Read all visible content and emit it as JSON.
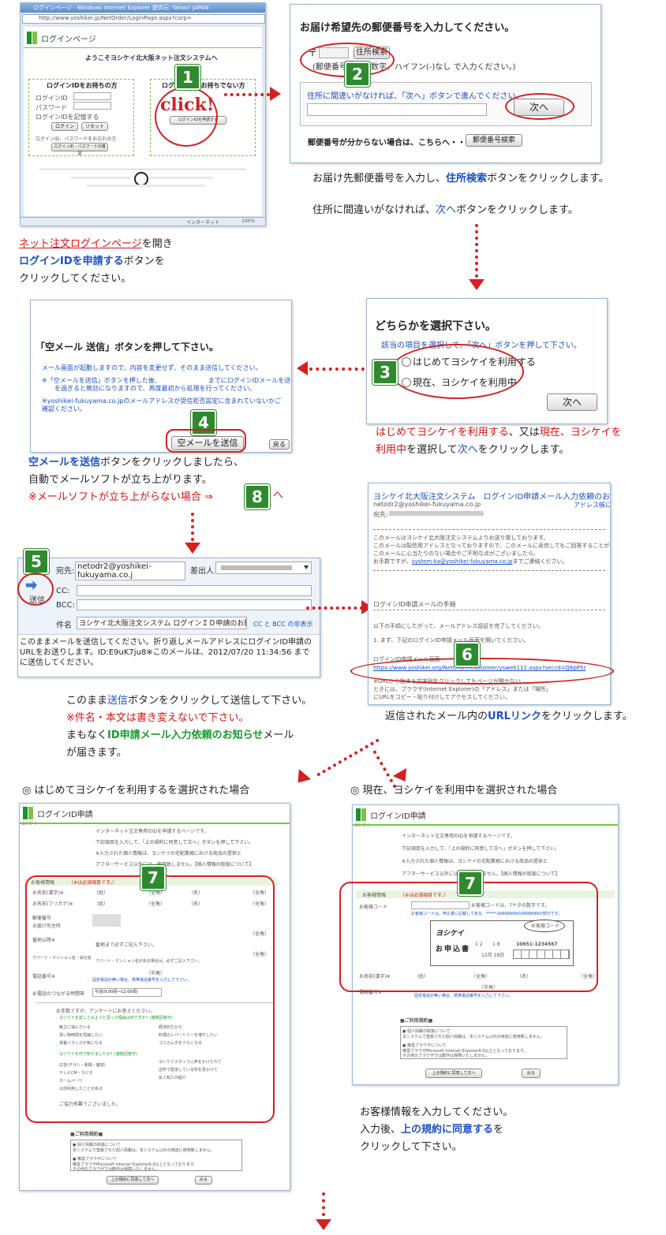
{
  "step1": {
    "window_title": "ログインページ - Windows Internet Explorer 提供元: Yahoo! JAPAN",
    "address": "http://www.yoshikei.jp/NetOrder/LoginPage.aspx?corp=",
    "page_header": "ログインページ",
    "welcome": "ようこそヨシケイ北大阪ネット注文システムへ",
    "box_left_title": "ログインIDをお持ちの方",
    "box_right_title": "ログインIDをお持ちでない方",
    "login_id_label": "ログインID",
    "password_label": "パスワード",
    "remember_label": "ログインIDを記憶する",
    "login_btn": "ログイン",
    "reset_btn": "リセット",
    "forgot_label": "ログインID、パスワードをお忘れの方",
    "forgot_btn": "ログインID・パスワードの確認",
    "apply_btn": "ログインIDを申請する",
    "click_text": "click!",
    "status_internet": "インターネット",
    "status_zoom": "100%",
    "caption_link": "ネット注文ログインページ",
    "caption_line1_rest": "を開き",
    "caption_blue": "ログインIDを申請する",
    "caption_line2_rest": "ボタンを",
    "caption_line3": "クリックしてください。"
  },
  "step2": {
    "heading": "お届け希望先の郵便番号を入力してください。",
    "postal_mark": "〒",
    "search_btn": "住所検索",
    "hint": "(郵便番号は半角数字、ハイフン(-)なし で入力ください。)",
    "address_prompt": "住所に間違いがなければ、「次へ」ボタンで進んでください。",
    "next_btn": "次へ",
    "unknown_label": "郵便番号が分からない場合は、こちらへ・・・",
    "postal_search_btn": "郵便番号検索",
    "caption1_pre": "お届け先郵便番号を入力し、",
    "caption1_blue": "住所検索",
    "caption1_post": "ボタンをクリックします。",
    "caption2_pre": "住所に間違いがなければ、",
    "caption2_blue": "次へ",
    "caption2_post": "ボタンをクリックします。"
  },
  "step3": {
    "heading": "どちらかを選択下さい。",
    "sub": "該当の項目を選択して、「次へ」ボタンを押して下さい。",
    "opt1": "はじめてヨシケイを利用する",
    "opt2": "現在、ヨシケイを利用中",
    "next_btn": "次へ",
    "caption_red1": "はじめてヨシケイを利用する",
    "caption_mid": "、又は",
    "caption_red2": "現在、ヨシケイを",
    "caption_red3": "利用中",
    "caption_mid2": "を選択して",
    "caption_blue": "次へ",
    "caption_end": "をクリックします。"
  },
  "step4": {
    "heading": "「空メール 送信」ボタンを押して下さい。",
    "line1": "メール画面が起動しますので、内容を変更せず、そのまま送信してください。",
    "line2": "※「空メールを送信」ボタンを押した後、　　　　　　　　までにログインIDメールを送信してください。",
    "line3": "　　を過ぎると無効になりますので、再度最初から処理を行ってください。",
    "line4": "※yoshikei-fukuyama.co.jpのメールアドレスが受信拒否設定に含まれていないかご",
    "line5": "確認ください。",
    "send_btn": "空メールを送信",
    "back_btn": "戻る",
    "caption_blue": "空メールを送信",
    "caption1_post": "ボタンをクリックしましたら、",
    "caption2": "自動でメールソフトが立ち上がります。",
    "caption3_red": "※メールソフトが立ち上がらない場合 ⇒",
    "caption3_badge": "8",
    "caption3_tail": "へ"
  },
  "step5": {
    "to_label": "宛先:",
    "to_value": "netodr2@yoshikei-fukuyama.co.j",
    "from_label": "差出人",
    "send_label": "送信",
    "cc_label": "CC:",
    "bcc_label": "BCC:",
    "subject_label": "件名",
    "subject_value": "ヨシケイ北大阪注文システム ログインＩＤ申請のお願い。",
    "ccbcc_link": "CC と BCC の非表示",
    "body": "このままメールを送信してください。折り返しメールアドレスにログインID申請のURLをお送りします。ID:E9uK7ju8※このメールは、2012/07/20 11:34:56 までに送信してください。",
    "caption1_pre": "このまま",
    "caption1_blue": "送信",
    "caption1_post": "ボタンをクリックして送信して下さい。",
    "caption2_red": "※件名・本文は書き変えないで下さい。",
    "caption3_pre": "まもなく",
    "caption3_green": "ID申請メール入力依頼のお知らせ",
    "caption3_post": "メール",
    "caption4": "が届きます。"
  },
  "step6": {
    "title": "ヨシケイ北大阪注文システム　ログインID申請メール入力依頼のお知らせ",
    "from": "netodr2@yoshikei-fukuyama.co.jp",
    "from_link": "アドレス帳に追加",
    "to_label": "宛先:",
    "p1": "このメールはヨシケイ北大阪注文システムよりお送り致しております。",
    "p2": "このメールは配信用アドレスとなっておりますので、このメールに返信してもご回答することが",
    "p3": "このメールに心当たりのない場合やご不明な点がございましたら、",
    "p4": "お手数ですが、",
    "p4_link": "system-ka@yoshikei-fukuyama.co.jp",
    "p4_end": "までご連絡ください。",
    "section": "ログインID申請メールの手順",
    "p5": "以下の手順にしたがって、メールアドレス認証を完了してください。",
    "p6": "1. まず、下記のログインID申請メール画面を開いてください。",
    "p7": "ログインID申請メール画面",
    "url": "https://www.yoshikei.org/NetOrder/Customer/ysweb111.aspx?seccd=Q8pP5r",
    "p8": "※URLから始まる文字列をクリックしてもページが開かない",
    "p9": "ときには、ブラウザ(Internet Explorer)の「アドレス」または「場所」",
    "p10": "にURLをコピー・貼り付けしてアクセスしてください。",
    "caption_pre": "返信されたメール内の",
    "caption_blue": "URLリンク",
    "caption_post": "をクリックします。"
  },
  "step7": {
    "left_heading": "◎ はじめてヨシケイを利用するを選択された場合",
    "right_heading": "◎ 現在、ヨシケイを利用中を選択された場合",
    "page_header": "ログインID申請",
    "logo_text": "ヨシケイ",
    "intro1": "インターネット注文専用のIDを申請するページです。",
    "intro2": "下記項目を入力して、「上の規約に同意して次へ」ボタンを押して下さい。",
    "intro3": "※入力された個人情報は、ヨシケイの宅配業務における商品の提供と",
    "intro4": "アフターサービス以外には、使用致しません。【個人情報の取扱について】",
    "customer_info": "お客様情報",
    "required_note": "（※は必須項目です。）",
    "name_label": "お名前(漢字)※",
    "kana_label": "お名前(フリガナ)※",
    "sei": "（姓）",
    "mei": "（名）",
    "zenkaku": "（全角）",
    "postal_label": "郵便番号",
    "address_label": "お届け先住所",
    "banchi_label": "番地以降※",
    "banchi_hint": "番地まで必ずご記入下さい。",
    "apart_label": "アパート・マンション名・会社名",
    "apart_hint": "アパート・マンション名がある場合は、必ずご記入下さい。",
    "phone_label": "電話番号※",
    "phone_hint": "固定電話が無い場合、携帯電話番号を入力して下さい。",
    "hankaku": "（半角）",
    "time_label": "お電話のつながる時間帯",
    "time_value": "午前(9:00頃～12:00頃)",
    "survey_intro": "お手数ですが、アンケートにお答えください。",
    "q1": "ヨシケイを試してみようと思った理由は何ですか？(複数回答可)",
    "q1_opts": [
      "献立に悩んでいる",
      "買い物時間を短縮したい",
      "栄養バランスが気になる",
      "経済的だから",
      "料理のレパートリーを増やしたい",
      "ゴミのムダを少なくなる"
    ],
    "q2": "ヨシケイを何で知りましたか？(複数回答可)",
    "q2_opts": [
      "広告(チラシ・新聞・雑誌)",
      "テレビCM・ラジオ",
      "ホームページ",
      "以前利用したことがある",
      "ヨシケイスタッフに声をかけられて",
      "近所で配達している所を見かけて",
      "友人知人の紹介"
    ],
    "survey_thanks": "ご協力有難うございました。",
    "terms_title": "■ご利用規約■",
    "terms1": "● 個人情報の取扱について",
    "terms2": "本システムで登録された個人情報は、本システム以外の用途に使用致しません。",
    "terms3": "● 推奨ブラウザについて",
    "terms4": "推奨ブラウザMicrosoft Internet Explorer6.0以上となっております。",
    "terms5": "その他のブラウザでは動作は保障いたしません。",
    "agree_btn": "上の規約に同意して次へ",
    "back_btn": "戻る",
    "customer_code_label": "お客様コード",
    "code_note1": "お客様コードは、7ケタの数字です。",
    "code_note2": "お客様コードは、申込書に記載してある、*****-99999999の9999999の部分です。",
    "card_logo": "ヨシケイ",
    "card_label": "お申込書",
    "card_num1": "1 2",
    "card_num2": "1 8",
    "card_date": "12月 18日",
    "card_code": "10651-1234567",
    "callout": "お客様コード",
    "badge": "7",
    "caption1": "お客様情報を入力してください。",
    "caption2_pre": "入力後、",
    "caption2_blue": "上の規約に同意する",
    "caption2_post": "を",
    "caption3": "クリックして下さい。"
  },
  "badges": {
    "b1": "1",
    "b2": "2",
    "b3": "3",
    "b4": "4",
    "b5": "5",
    "b6": "6"
  },
  "colors": {
    "accent_red": "#d52020",
    "badge_green": "#2f8a2f",
    "link_blue": "#1b4fc4",
    "header_green": "#1f8f2f"
  }
}
